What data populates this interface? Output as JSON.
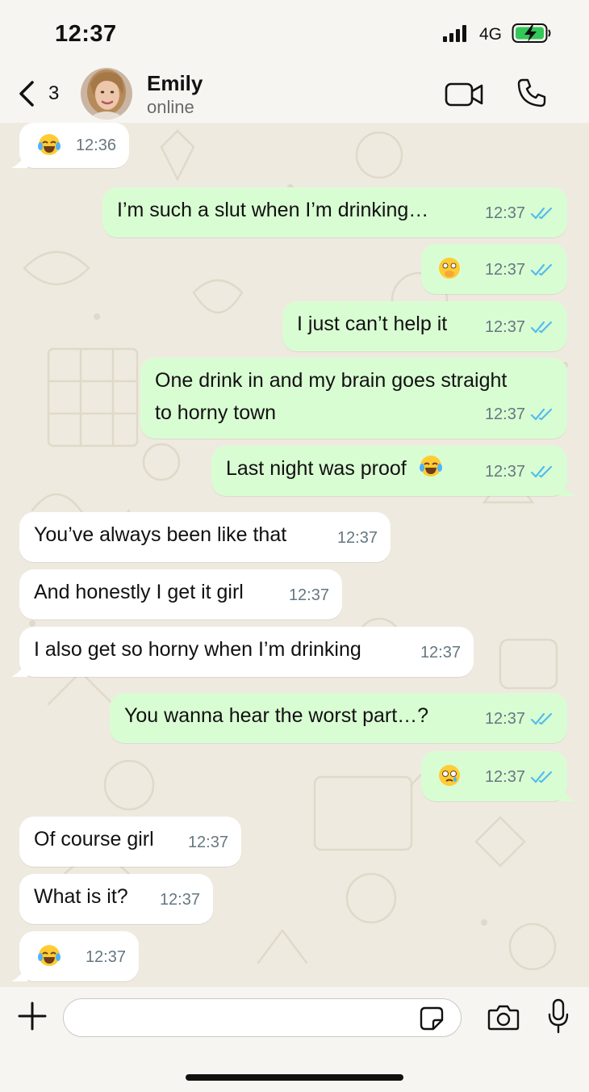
{
  "status_bar": {
    "time": "12:37",
    "network": "4G",
    "battery_charging": true,
    "battery_color": "#34c759"
  },
  "header": {
    "back_count": "3",
    "contact_name": "Emily",
    "contact_status": "online",
    "icons": [
      "chevron-left-icon",
      "video-call-icon",
      "phone-icon"
    ]
  },
  "colors": {
    "incoming_bubble": "#ffffff",
    "outgoing_bubble": "#d9fdd3",
    "read_ticks": "#53bdeb",
    "chat_background": "#efeae0"
  },
  "messages": [
    {
      "dir": "in",
      "text": "",
      "emoji": "tears-of-joy",
      "time": "12:36"
    },
    {
      "dir": "out",
      "text": "I’m such a slut when I’m drinking…",
      "time": "12:37",
      "read": true
    },
    {
      "dir": "out",
      "text": "",
      "emoji": "flushed-hand-over-mouth",
      "time": "12:37",
      "read": true
    },
    {
      "dir": "out",
      "text": "I just can’t help it",
      "time": "12:37",
      "read": true
    },
    {
      "dir": "out",
      "text_lines": [
        "One drink in and my brain goes straight",
        "to horny town"
      ],
      "time": "12:37",
      "read": true
    },
    {
      "dir": "out",
      "text": "Last night was proof",
      "emoji": "tears-of-joy",
      "time": "12:37",
      "read": true
    },
    {
      "dir": "in",
      "text": "You’ve always been like that",
      "time": "12:37"
    },
    {
      "dir": "in",
      "text": "And honestly I get it girl",
      "time": "12:37"
    },
    {
      "dir": "in",
      "text": "I also get so horny when I’m drinking",
      "time": "12:37"
    },
    {
      "dir": "out",
      "text": "You wanna hear the worst part…?",
      "time": "12:37",
      "read": true
    },
    {
      "dir": "out",
      "text": "",
      "emoji": "holding-back-tears",
      "time": "12:37",
      "read": true
    },
    {
      "dir": "in",
      "text": "Of course girl",
      "time": "12:37"
    },
    {
      "dir": "in",
      "text": "What is it?",
      "time": "12:37"
    },
    {
      "dir": "in",
      "text": "",
      "emoji": "tears-of-joy",
      "time": "12:37"
    }
  ],
  "input": {
    "placeholder": "",
    "icons": [
      "plus-icon",
      "sticker-icon",
      "camera-icon",
      "microphone-icon"
    ]
  }
}
